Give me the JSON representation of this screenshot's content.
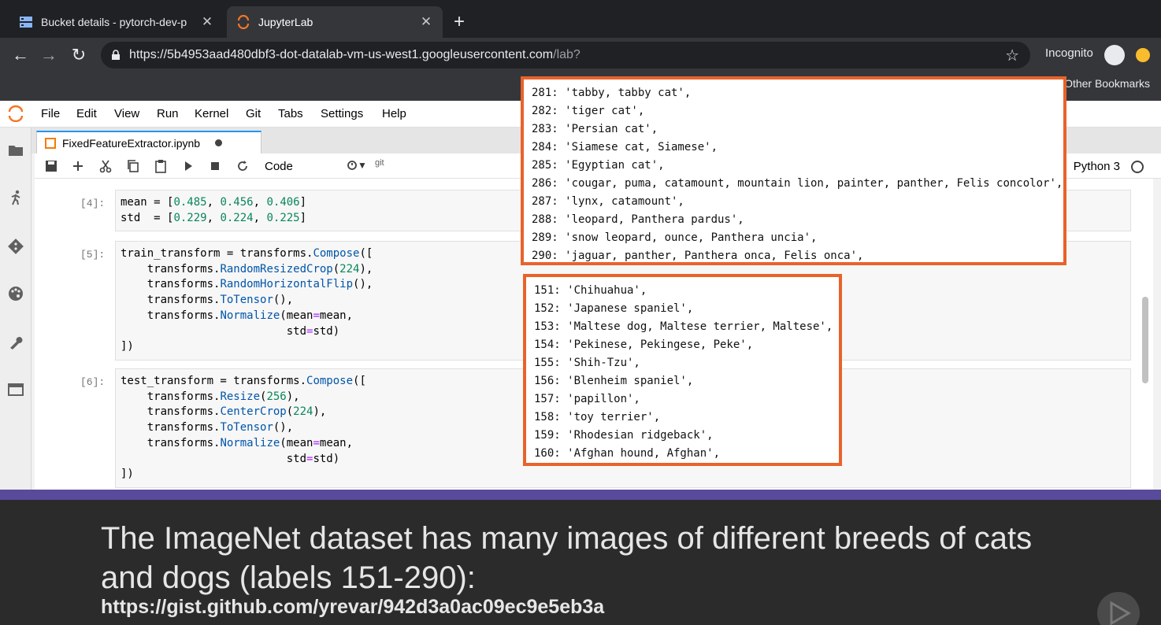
{
  "browser": {
    "tabs": [
      {
        "title": "Bucket details - pytorch-dev-p",
        "active": false
      },
      {
        "title": "JupyterLab",
        "active": true
      }
    ],
    "url_main": "https://5b4953aad480dbf3-dot-datalab-vm-us-west1.googleusercontent.com",
    "url_path": "/lab?",
    "incognito_label": "Incognito",
    "other_bookmarks": "Other Bookmarks"
  },
  "jupyter": {
    "menu": [
      "File",
      "Edit",
      "View",
      "Run",
      "Kernel",
      "Git",
      "Tabs",
      "Settings",
      "Help"
    ],
    "notebook_tab": "FixedFeatureExtractor.ipynb",
    "cell_type": "Code",
    "git_label": "git",
    "kernel_name": "Python 3",
    "cells": [
      {
        "prompt": "[4]:"
      },
      {
        "prompt": "[5]:"
      },
      {
        "prompt": "[6]:"
      }
    ]
  },
  "overlay_cats": [
    "281: 'tabby, tabby cat',",
    "282: 'tiger cat',",
    "283: 'Persian cat',",
    "284: 'Siamese cat, Siamese',",
    "285: 'Egyptian cat',",
    "286: 'cougar, puma, catamount, mountain lion, painter, panther, Felis concolor',",
    "287: 'lynx, catamount',",
    "288: 'leopard, Panthera pardus',",
    "289: 'snow leopard, ounce, Panthera uncia',",
    "290: 'jaguar, panther, Panthera onca, Felis onca',"
  ],
  "overlay_dogs": [
    "151: 'Chihuahua',",
    "152: 'Japanese spaniel',",
    "153: 'Maltese dog, Maltese terrier, Maltese',",
    "154: 'Pekinese, Pekingese, Peke',",
    "155: 'Shih-Tzu',",
    "156: 'Blenheim spaniel',",
    "157: 'papillon',",
    "158: 'toy terrier',",
    "159: 'Rhodesian ridgeback',",
    "160: 'Afghan hound, Afghan',"
  ],
  "caption": {
    "text": "The ImageNet dataset has many images of different breeds of cats and dogs (labels 151-290):",
    "link": "https://gist.github.com/yrevar/942d3a0ac09ec9e5eb3a"
  },
  "colors": {
    "accent_orange": "#e8632b",
    "purple_bar": "#5a4a9c"
  }
}
